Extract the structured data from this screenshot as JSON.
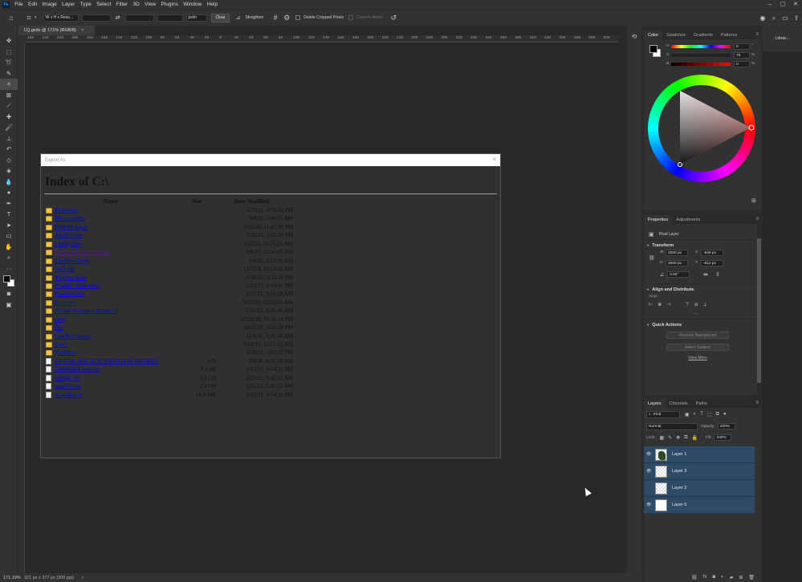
{
  "app": {
    "logo": "Ps"
  },
  "menus": [
    "File",
    "Edit",
    "Image",
    "Layer",
    "Type",
    "Select",
    "Filter",
    "3D",
    "View",
    "Plugins",
    "Window",
    "Help"
  ],
  "window_controls": [
    "–",
    "▢",
    "✕"
  ],
  "options_bar": {
    "ratio_select": "W x H x Reso...",
    "unit_select": "px/in",
    "clear_label": "Clear",
    "straighten_label": "Straighten",
    "delete_cropped_label": "Delete Cropped Pixels",
    "content_aware_label": "Content-Aware"
  },
  "document_tab": {
    "title": "ĽQ.gvdc @ 171% (RGB/8)",
    "close": "×"
  },
  "ruler_labels": [
    "180",
    "240",
    "220",
    "200",
    "180",
    "160",
    "140",
    "120",
    "100",
    "80",
    "60",
    "40",
    "20",
    "0",
    "20",
    "40",
    "60",
    "80",
    "100",
    "120",
    "140",
    "160",
    "180",
    "200",
    "220",
    "240",
    "260",
    "280",
    "300",
    "320",
    "340",
    "360",
    "380",
    "400",
    "420",
    "440",
    "460",
    "480",
    "500",
    "520",
    "540"
  ],
  "status_bar": {
    "zoom": "171.19%",
    "doc_info": "321 px x 377 px (300 ppi)"
  },
  "export_dialog": {
    "title": "Export As",
    "close": "×",
    "heading": "Index of C:\\",
    "columns": {
      "name": "Name",
      "size": "Size",
      "date": "Date Modified"
    },
    "entries": [
      {
        "name": "$Software",
        "type": "folder",
        "size": "",
        "date": "3/29/21, 9:50:24 PM"
      },
      {
        "name": "$Recycle.Bin",
        "type": "folder",
        "size": "",
        "date": "9/8/20, 3:41:11 AM"
      },
      {
        "name": "$WinREAgent",
        "type": "folder",
        "size": "",
        "date": "9/19/20, 11:47:00 PM"
      },
      {
        "name": "AdobeTemp",
        "type": "folder",
        "size": "",
        "date": "5/20/21, 3:25:39 PM"
      },
      {
        "name": "Config.Msi",
        "type": "folder",
        "size": "",
        "date": "5/23/21, 11:21:21 AM"
      },
      {
        "name": "Documents and Settings",
        "type": "folder",
        "size": "",
        "date": "9/8/20, 12:16:45 AM",
        "visited": true
      },
      {
        "name": "OneDriveTemp",
        "type": "folder",
        "size": "",
        "date": "9/8/20, 2:24:18 AM"
      },
      {
        "name": "PerfLogs",
        "type": "folder",
        "size": "",
        "date": "12/7/19, 11:14:52 AM"
      },
      {
        "name": "Program Files",
        "type": "folder",
        "size": "",
        "date": "5/20/21, 3:12:11 PM"
      },
      {
        "name": "Program Files (x86)",
        "type": "folder",
        "size": "",
        "date": "2/13/21, 6:49:41 PM"
      },
      {
        "name": "ProgramData",
        "type": "folder",
        "size": "",
        "date": "5/25/21, 9:45:28 AM"
      },
      {
        "name": "Recovery",
        "type": "folder",
        "size": "",
        "date": "9/24/20, 12:22:45 AM"
      },
      {
        "name": "System Volume Information",
        "type": "folder",
        "size": "",
        "date": "5/21/21, 9:38:46 AM"
      },
      {
        "name": "temp",
        "type": "folder",
        "size": "",
        "date": "12/21/20, 10:36:14 PM"
      },
      {
        "name": "tmp",
        "type": "folder",
        "size": "",
        "date": "11/21/20, 4:52:20 PM"
      },
      {
        "name": "UserBenchmark",
        "type": "folder",
        "size": "",
        "date": "11/8/20, 5:06:46 AM"
      },
      {
        "name": "Users",
        "type": "folder",
        "size": "",
        "date": "9/24/20, 12:17:53 AM"
      },
      {
        "name": "Windows",
        "type": "folder",
        "size": "",
        "date": "5/20/21, 3:22:22 PM"
      },
      {
        "name": "$WINRE_BACKUP_PARTITION.MARKER",
        "type": "file",
        "size": "0 B",
        "date": "9/8/20, 8:37:38 AM"
      },
      {
        "name": "DumpStack.log.tmp",
        "type": "file",
        "size": "8.0 kB",
        "date": "5/15/21, 8:54:31 PM"
      },
      {
        "name": "hiberfil.sys",
        "type": "file",
        "size": "6.4 GB",
        "date": "5/25/21, 9:42:11 AM"
      },
      {
        "name": "pagefile.sys",
        "type": "file",
        "size": "2.4 GB",
        "date": "5/25/21, 1:26:33 AM"
      },
      {
        "name": "swapfile.sys",
        "type": "file",
        "size": "16.0 MB",
        "date": "5/15/21, 8:54:31 PM"
      }
    ]
  },
  "color_panel": {
    "tabs": [
      "Color",
      "Swatches",
      "Gradients",
      "Patterns"
    ],
    "sliders": [
      {
        "label": "H",
        "value": "0",
        "unit": "°"
      },
      {
        "label": "S",
        "value": "75",
        "unit": "%"
      },
      {
        "label": "B",
        "value": "0",
        "unit": "%"
      }
    ]
  },
  "properties_panel": {
    "tabs": [
      "Properties",
      "Adjustments"
    ],
    "kind": "Pixel Layer",
    "transform_title": "Transform",
    "w_label": "W",
    "w_value": "2000 px",
    "h_label": "H",
    "h_value": "2000 px",
    "x_label": "X",
    "x_value": "-849 px",
    "y_label": "Y",
    "y_value": "-812 px",
    "angle_value": "0.00°",
    "align_title": "Align and Distribute",
    "align_label": "Align:",
    "quick_actions_title": "Quick Actions",
    "remove_bg": "Remove Background",
    "select_subject": "Select Subject",
    "view_more": "View More"
  },
  "layers_panel": {
    "tabs": [
      "Layers",
      "Channels",
      "Paths"
    ],
    "kind_filter": "Kind",
    "blend_mode": "Normal",
    "opacity_label": "Opacity:",
    "opacity_value": "100%",
    "lock_label": "Lock:",
    "fill_label": "Fill:",
    "fill_value": "100%",
    "layers": [
      {
        "name": "Layer 1",
        "visible": true,
        "thumb": "art"
      },
      {
        "name": "Layer 3",
        "visible": true,
        "thumb": "checker"
      },
      {
        "name": "Layer 2",
        "visible": false,
        "thumb": "checker"
      },
      {
        "name": "Layer 0",
        "visible": true,
        "thumb": "white"
      }
    ]
  },
  "libraries_label": "Librar..."
}
